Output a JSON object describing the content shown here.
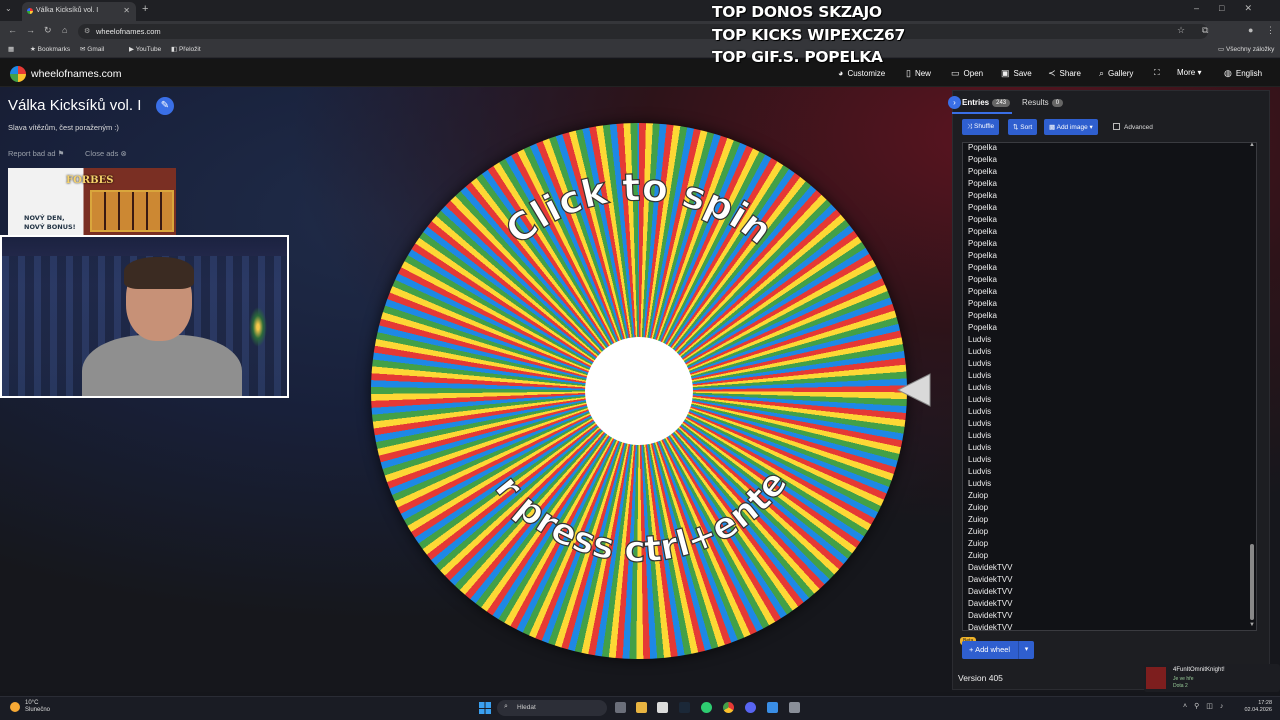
{
  "browser": {
    "tab_title": "Válka Kicksíků vol. I",
    "new_tab": "+",
    "url": "wheelofnames.com",
    "bookmarks": [
      "Bookmarks",
      "Gmail",
      "YouTube",
      "Přeložit"
    ],
    "all_bookmarks": "Všechny záložky"
  },
  "overlay": {
    "lines": [
      "TOP DONOS SKZAJO",
      "TOP KICKS WIPEXCZ67",
      "TOP GIF.S.  POPELKA"
    ]
  },
  "header": {
    "site_name": "wheelofnames.com",
    "menu": {
      "customize": "Customize",
      "new": "New",
      "open": "Open",
      "save": "Save",
      "share": "Share",
      "gallery": "Gallery",
      "more": "More",
      "language": "English"
    }
  },
  "page": {
    "title": "Válka Kicksíků vol. I",
    "subtitle": "Slava vítězům, čest poraženým :)",
    "report_ad": "Report bad ad",
    "close_ads": "Close ads",
    "ad": {
      "brand": "FORBES",
      "line1": "NOVÝ DEN,",
      "line2": "NOVÝ BONUS!"
    }
  },
  "wheel": {
    "top_text": "Click to spin",
    "bottom_text": "or press ctrl+enter",
    "segment_colors": [
      "#e53935",
      "#fdd835",
      "#43a047",
      "#1e88e5"
    ]
  },
  "panel": {
    "tab_entries": "Entries",
    "entries_count": "243",
    "tab_results": "Results",
    "results_count": "0",
    "shuffle": "Shuffle",
    "sort": "Sort",
    "add_image": "Add image",
    "advanced": "Advanced",
    "entries": [
      "Popelka",
      "Popelka",
      "Popelka",
      "Popelka",
      "Popelka",
      "Popelka",
      "Popelka",
      "Popelka",
      "Popelka",
      "Popelka",
      "Popelka",
      "Popelka",
      "Popelka",
      "Popelka",
      "Popelka",
      "Popelka",
      "Ludvis",
      "Ludvis",
      "Ludvis",
      "Ludvis",
      "Ludvis",
      "Ludvis",
      "Ludvis",
      "Ludvis",
      "Ludvis",
      "Ludvis",
      "Ludvis",
      "Ludvis",
      "Ludvis",
      "Zuiop",
      "Zuiop",
      "Zuiop",
      "Zuiop",
      "Zuiop",
      "Zuiop",
      "DavidekTVV",
      "DavidekTVV",
      "DavidekTVV",
      "DavidekTVV",
      "DavidekTVV",
      "DavidekTVV",
      "DavidekTVV"
    ],
    "beta": "Beta",
    "add_wheel": "Add wheel",
    "version": "Version 405"
  },
  "notification": {
    "name": "4FunItOmnitKnight!",
    "line2": "Je ve hře",
    "line3": "Dota 2"
  },
  "taskbar": {
    "temp": "10°C",
    "weather": "Slunečno",
    "search": "Hledat",
    "time": "17:28",
    "date": "02.04.2026"
  },
  "colors": {
    "accent": "#3a6fe6",
    "button": "#2f5fcf"
  }
}
